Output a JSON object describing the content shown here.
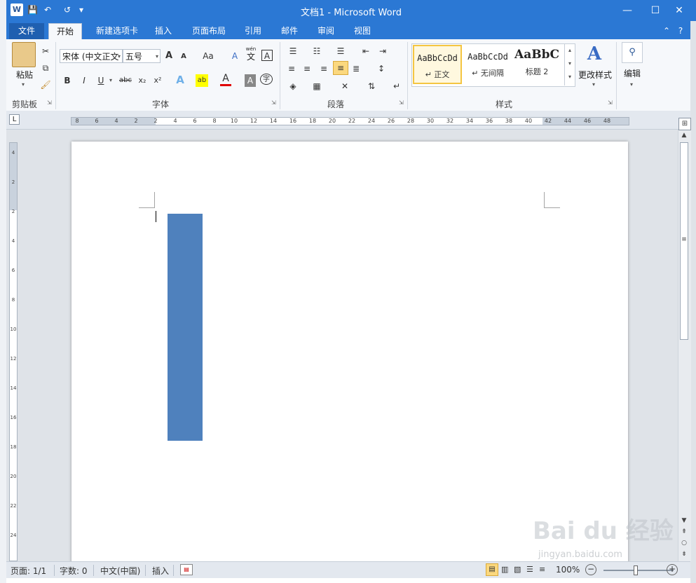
{
  "window": {
    "title": "文档1 - Microsoft Word",
    "app_icon_letter": "W",
    "quick_access": {
      "save": "💾",
      "undo": "↶",
      "redo": "↺",
      "customize": "▾"
    },
    "controls": {
      "minimize": "—",
      "maximize": "☐",
      "close": "✕"
    }
  },
  "tabs": {
    "items": [
      "文件",
      "开始",
      "新建选项卡",
      "插入",
      "页面布局",
      "引用",
      "邮件",
      "审阅",
      "视图"
    ],
    "active": "开始",
    "right_icons": {
      "collapse": "⌃",
      "help": "?"
    }
  },
  "ribbon": {
    "clipboard": {
      "paste_label": "粘贴",
      "group_label": "剪贴板"
    },
    "font": {
      "font_name": "宋体 (中文正文",
      "font_size": "五号",
      "grow": "A",
      "shrink": "A",
      "change_case": "Aa",
      "clear_format": "A",
      "phonetic_top": "wén",
      "phonetic_char": "文",
      "char_border": "A",
      "bold": "B",
      "italic": "I",
      "underline": "U",
      "strikethrough": "abc",
      "subscript": "x₂",
      "superscript": "x²",
      "text_effect": "A",
      "highlight": "ab",
      "font_color": "A",
      "char_shading": "A",
      "enclose_char": "字",
      "group_label": "字体"
    },
    "paragraph": {
      "group_label": "段落"
    },
    "styles": {
      "items": [
        {
          "sample": "AaBbCcDd",
          "name": "↵ 正文"
        },
        {
          "sample": "AaBbCcDd",
          "name": "↵ 无间隔"
        },
        {
          "sample": "AaBbC",
          "name": "标题 2"
        }
      ],
      "change_styles": "更改样式",
      "group_label": "样式"
    },
    "editing": {
      "label": "编辑"
    }
  },
  "ruler": {
    "ticks": [
      "8",
      "6",
      "4",
      "2",
      "2",
      "4",
      "6",
      "8",
      "10",
      "12",
      "14",
      "16",
      "18",
      "20",
      "22",
      "24",
      "26",
      "28",
      "30",
      "32",
      "34",
      "36",
      "38",
      "40",
      "42",
      "44",
      "46",
      "48"
    ]
  },
  "vruler": {
    "ticks": [
      "4",
      "2",
      "2",
      "4",
      "6",
      "8",
      "10",
      "12",
      "14",
      "16",
      "18",
      "20",
      "22",
      "24"
    ]
  },
  "status": {
    "page": "页面: 1/1",
    "words": "字数: 0",
    "language": "中文(中国)",
    "mode": "插入",
    "zoom": "100%",
    "zoom_minus": "−",
    "zoom_plus": "+"
  },
  "watermark": {
    "main": "Bai du 经验",
    "sub": "jingyan.baidu.com"
  },
  "colors": {
    "titlebar": "#2b78d4",
    "shape": "#4f81bd",
    "active_style": "#f4c542"
  }
}
